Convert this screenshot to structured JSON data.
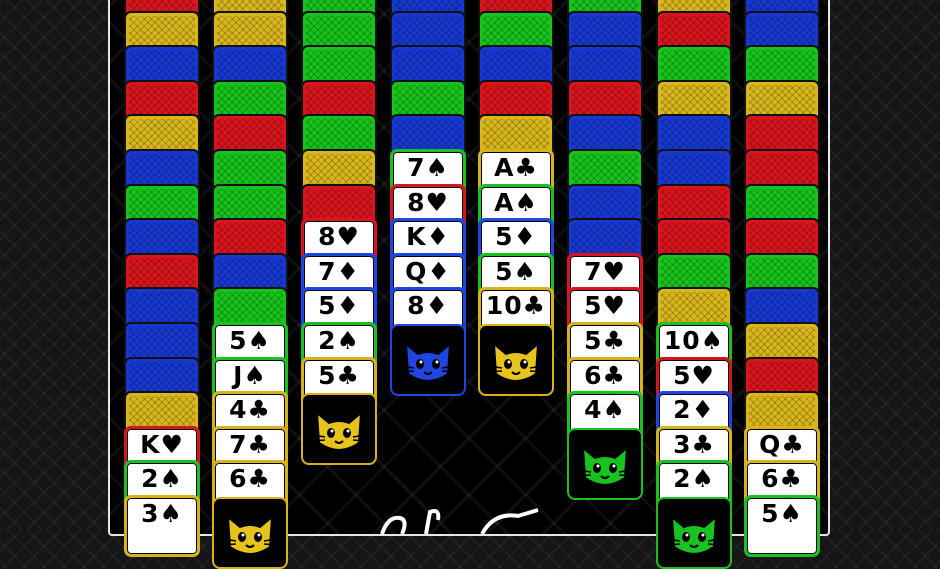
{
  "theme": {
    "red": "#d8141c",
    "blue": "#1637d0",
    "green": "#17c21d",
    "yellow": "#d8b61c"
  },
  "columns": [
    {
      "backs": [
        "red",
        "yellow",
        "blue",
        "red",
        "yellow",
        "blue",
        "green",
        "blue",
        "red",
        "blue",
        "blue",
        "blue",
        "yellow"
      ],
      "faces": [
        {
          "label": "K♥",
          "border": "red"
        },
        {
          "label": "2♠",
          "border": "green"
        },
        {
          "label": "3♠",
          "border": "yellow"
        }
      ],
      "cat": null
    },
    {
      "backs": [
        "yellow",
        "yellow",
        "blue",
        "green",
        "red",
        "green",
        "green",
        "red",
        "blue",
        "green"
      ],
      "faces": [
        {
          "label": "5♠",
          "border": "green"
        },
        {
          "label": "J♠",
          "border": "green"
        },
        {
          "label": "4♣",
          "border": "yellow"
        },
        {
          "label": "7♣",
          "border": "yellow"
        },
        {
          "label": "6♣",
          "border": "yellow"
        }
      ],
      "cat": {
        "color": "yellow",
        "partial": true
      }
    },
    {
      "backs": [
        "green",
        "green",
        "green",
        "red",
        "green",
        "yellow",
        "red"
      ],
      "faces": [
        {
          "label": "8♥",
          "border": "red"
        },
        {
          "label": "7♦",
          "border": "blue"
        },
        {
          "label": "5♦",
          "border": "blue"
        },
        {
          "label": "2♠",
          "border": "green"
        },
        {
          "label": "5♣",
          "border": "yellow"
        }
      ],
      "cat": {
        "color": "yellow",
        "partial": false
      }
    },
    {
      "backs": [
        "blue",
        "blue",
        "blue",
        "green",
        "blue"
      ],
      "faces": [
        {
          "label": "7♠",
          "border": "green"
        },
        {
          "label": "8♥",
          "border": "red"
        },
        {
          "label": "K♦",
          "border": "blue"
        },
        {
          "label": "Q♦",
          "border": "blue"
        },
        {
          "label": "8♦",
          "border": "blue"
        }
      ],
      "cat": {
        "color": "blue",
        "partial": false
      }
    },
    {
      "backs": [
        "red",
        "green",
        "blue",
        "red",
        "yellow"
      ],
      "faces": [
        {
          "label": "A♣",
          "border": "yellow"
        },
        {
          "label": "A♠",
          "border": "green"
        },
        {
          "label": "5♦",
          "border": "blue"
        },
        {
          "label": "5♠",
          "border": "green"
        },
        {
          "label": "10♣",
          "border": "yellow"
        }
      ],
      "cat": {
        "color": "yellow",
        "partial": false
      }
    },
    {
      "backs": [
        "green",
        "blue",
        "blue",
        "red",
        "blue",
        "green",
        "blue",
        "blue"
      ],
      "faces": [
        {
          "label": "7♥",
          "border": "red"
        },
        {
          "label": "5♥",
          "border": "red"
        },
        {
          "label": "5♣",
          "border": "yellow"
        },
        {
          "label": "6♣",
          "border": "yellow"
        },
        {
          "label": "4♠",
          "border": "green"
        }
      ],
      "cat": {
        "color": "green",
        "partial": false
      }
    },
    {
      "backs": [
        "yellow",
        "red",
        "green",
        "yellow",
        "blue",
        "blue",
        "red",
        "red",
        "green",
        "yellow"
      ],
      "faces": [
        {
          "label": "10♠",
          "border": "green"
        },
        {
          "label": "5♥",
          "border": "red"
        },
        {
          "label": "2♦",
          "border": "blue"
        },
        {
          "label": "3♣",
          "border": "yellow"
        },
        {
          "label": "2♠",
          "border": "green"
        }
      ],
      "cat": {
        "color": "green",
        "partial": true
      }
    },
    {
      "backs": [
        "blue",
        "blue",
        "green",
        "yellow",
        "red",
        "red",
        "green",
        "red",
        "green",
        "blue",
        "yellow",
        "red",
        "yellow"
      ],
      "faces": [
        {
          "label": "Q♣",
          "border": "yellow"
        },
        {
          "label": "6♣",
          "border": "yellow"
        },
        {
          "label": "5♠",
          "border": "green"
        }
      ],
      "cat": null
    }
  ]
}
